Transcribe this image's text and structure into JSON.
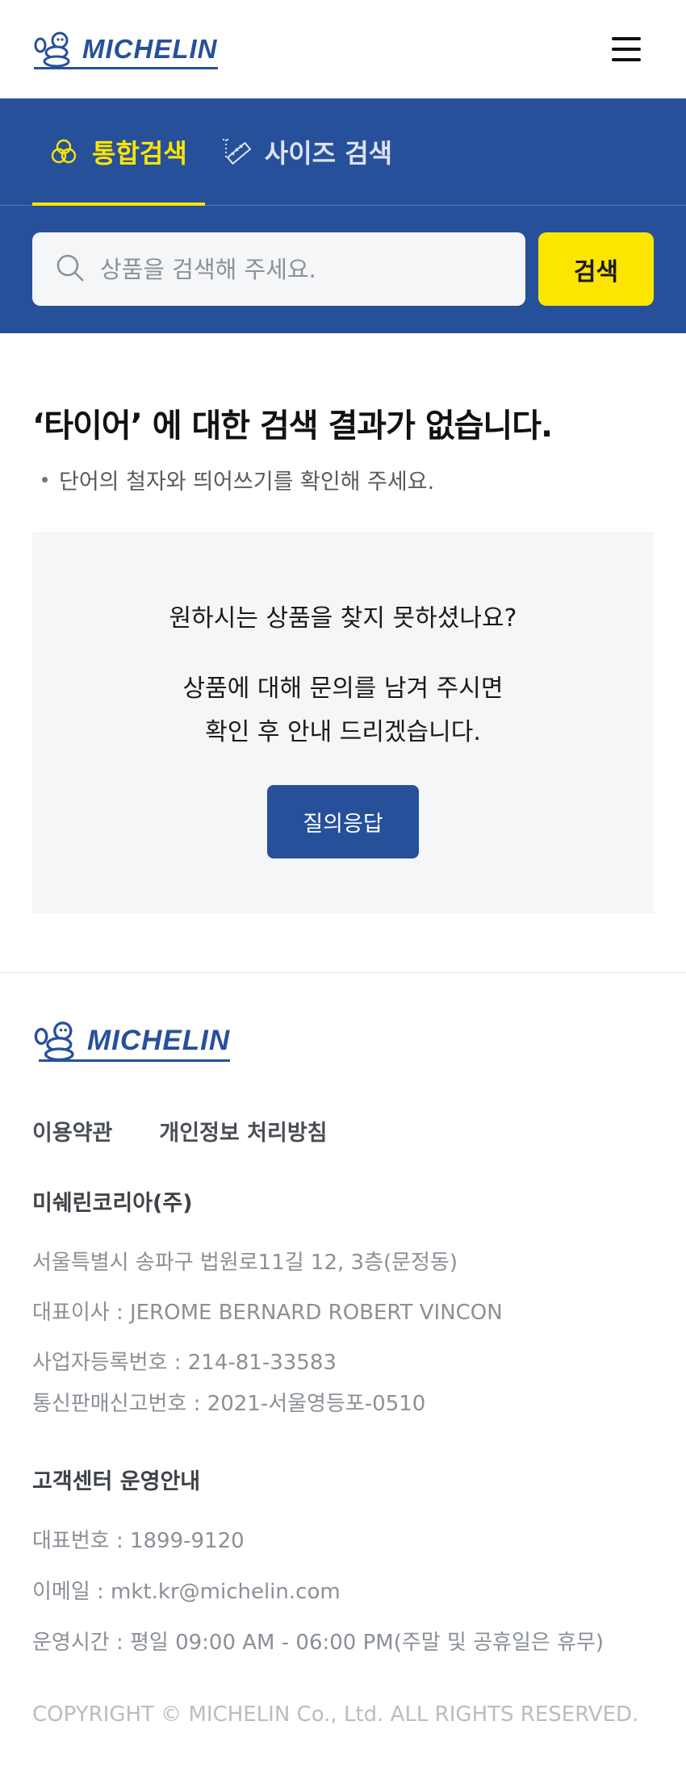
{
  "header": {
    "brand": "MICHELIN",
    "menu_icon": "hamburger-menu-icon"
  },
  "search": {
    "tabs": [
      {
        "label": "통합검색",
        "icon": "integrated-search-icon",
        "active": true
      },
      {
        "label": "사이즈 검색",
        "icon": "ruler-size-icon",
        "active": false
      }
    ],
    "placeholder": "상품을 검색해 주세요.",
    "button_label": "검색",
    "accent_color": "#fce500",
    "band_color": "#27509b"
  },
  "results": {
    "title": "‘타이어’ 에 대한 검색 결과가 없습니다.",
    "tip": "단어의 철자와 띄어쓰기를 확인해 주세요."
  },
  "help": {
    "question": "원하시는 상품을 찾지 못하셨나요?",
    "description": "상품에 대해 문의를 남겨 주시면\n확인 후 안내 드리겠습니다.",
    "button_label": "질의응답"
  },
  "footer": {
    "brand": "MICHELIN",
    "links": [
      "이용약관",
      "개인정보 처리방침"
    ],
    "company_name": "미쉐린코리아(주)",
    "address": "서울특별시 송파구 법원로11길 12, 3층(문정동)",
    "ceo": "대표이사 : JEROME BERNARD ROBERT VINCON",
    "business_number": "사업자등록번호 : 214-81-33583",
    "ecommerce_number": "통신판매신고번호 : 2021-서울영등포-0510",
    "cs_title": "고객센터 운영안내",
    "phone": "대표번호 : 1899-9120",
    "email": "이메일 : mkt.kr@michelin.com",
    "hours": "운영시간 : 평일 09:00 AM - 06:00 PM(주말 및 공휴일은 휴무)",
    "copyright": "COPYRIGHT © MICHELIN Co., Ltd. ALL RIGHTS RESERVED."
  }
}
